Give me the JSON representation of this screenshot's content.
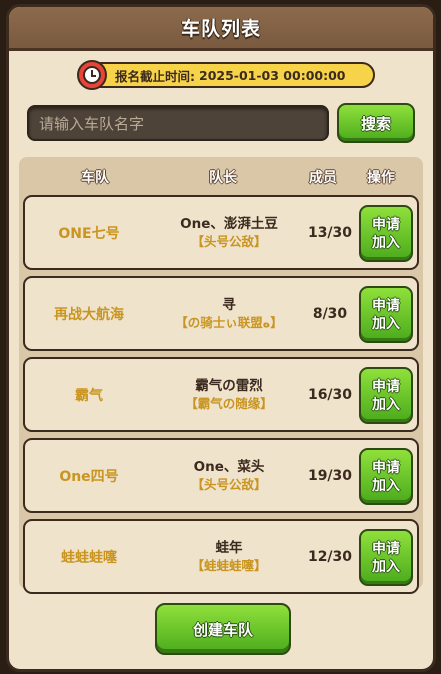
{
  "header": {
    "title": "车队列表"
  },
  "deadline": {
    "label": "报名截止时间:",
    "value": "2025-01-03 00:00:00"
  },
  "search": {
    "placeholder": "请输入车队名字",
    "button_label": "搜索"
  },
  "table": {
    "columns": {
      "team": "车队",
      "leader": "队长",
      "members": "成员",
      "action": "操作"
    },
    "rows": [
      {
        "team": "ONE七号",
        "leader": "One、澎湃土豆",
        "guild": "【头号公敌】",
        "members": "13/30",
        "apply_line1": "申请",
        "apply_line2": "加入"
      },
      {
        "team": "再战大航海",
        "leader": "寻",
        "guild": "【の骑士ぃ联盟ﻩ】",
        "members": "8/30",
        "apply_line1": "申请",
        "apply_line2": "加入"
      },
      {
        "team": "霸气",
        "leader": "霸气の雷烈",
        "guild": "【霸气の随缘】",
        "members": "16/30",
        "apply_line1": "申请",
        "apply_line2": "加入"
      },
      {
        "team": "One四号",
        "leader": "One、菜头",
        "guild": "【头号公敌】",
        "members": "19/30",
        "apply_line1": "申请",
        "apply_line2": "加入"
      },
      {
        "team": "蛙蛙蛙噻",
        "leader": "蛙年",
        "guild": "【蛙蛙蛙噻】",
        "members": "12/30",
        "apply_line1": "申请",
        "apply_line2": "加入"
      }
    ]
  },
  "footer": {
    "create_label": "创建车队"
  }
}
